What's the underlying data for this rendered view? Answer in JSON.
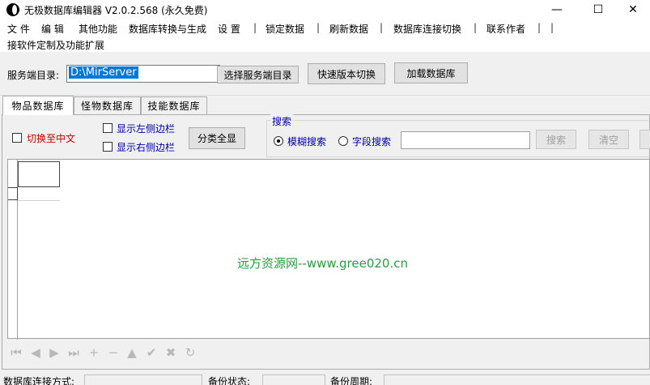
{
  "window": {
    "title": "无极数据库编辑器 V2.0.2.568 (永久免费)",
    "minimize_glyph": "—",
    "maximize_glyph": "☐",
    "close_glyph": "✕"
  },
  "menubar": {
    "items": [
      "文 件",
      "编 辑",
      "其他功能",
      "数据库转换与生成",
      "设 置",
      "|",
      "锁定数据",
      "|",
      "刷新数据",
      "|",
      "数据库连接切换",
      "|",
      "联系作者",
      "|",
      "|"
    ],
    "second_line": "接软件定制及功能扩展"
  },
  "toolbar": {
    "server_dir_label": "服务端目录:",
    "server_dir_value": "D:\\MirServer",
    "choose_dir_button": "选择服务端目录",
    "quick_switch_button": "快速版本切换",
    "load_db_button": "加载数据库"
  },
  "tabs": [
    "物品数据库",
    "怪物数据库",
    "技能数据库"
  ],
  "options": {
    "switch_chinese": "切换至中文",
    "show_left_sidebar": "显示左侧边栏",
    "show_right_sidebar": "显示右侧边栏",
    "show_all_categories_button": "分类全显"
  },
  "search": {
    "group_title": "搜索",
    "fuzzy_label": "模糊搜索",
    "field_label": "字段搜索",
    "search_button": "搜索",
    "clear_button": "清空",
    "input_value": ""
  },
  "watermark": "远方资源网--www.gree020.cn",
  "navigator": {
    "icons": [
      "first-record-icon",
      "prior-record-icon",
      "next-record-icon",
      "last-record-icon",
      "insert-record-icon",
      "delete-record-icon",
      "edit-record-icon",
      "post-edit-icon",
      "cancel-edit-icon",
      "refresh-data-icon"
    ],
    "glyphs": [
      "⏮",
      "◀",
      "▶",
      "⏭",
      "+",
      "−",
      "▲",
      "✔",
      "✖",
      "↻"
    ]
  },
  "statusbar": {
    "connection_label": "数据库连接方式:",
    "backup_status_label": "备份状态:",
    "backup_cycle_label": "备份周期:"
  },
  "colors": {
    "selection": "#0078d7",
    "chinese_toggle_label": "#c00000",
    "blue_label": "#0000a0",
    "watermark": "#2a9d40"
  }
}
